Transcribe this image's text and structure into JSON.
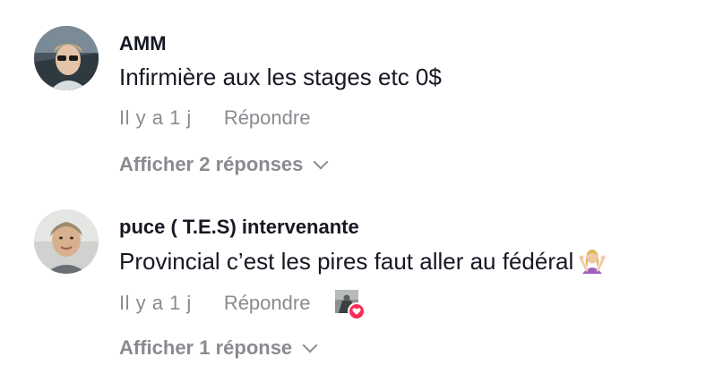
{
  "comments": [
    {
      "username": "AMM",
      "text": "Infirmière aux les stages etc 0$",
      "time": "Il y a 1 j",
      "reply_label": "Répondre",
      "view_replies": "Afficher 2 réponses",
      "avatar_icon": "user-avatar-photo"
    },
    {
      "username": "puce ( T.E.S) intervenante",
      "text": "Provincial c’est les pires faut aller au fédéral",
      "emoji": "person-shrugging-emoji",
      "time": "Il y a 1 j",
      "reply_label": "Répondre",
      "liked_by_creator": true,
      "view_replies": "Afficher 1 réponse",
      "avatar_icon": "user-avatar-photo"
    }
  ],
  "colors": {
    "primary_text": "#161823",
    "secondary_text": "#8a8b91",
    "heart": "#fe2c55"
  }
}
